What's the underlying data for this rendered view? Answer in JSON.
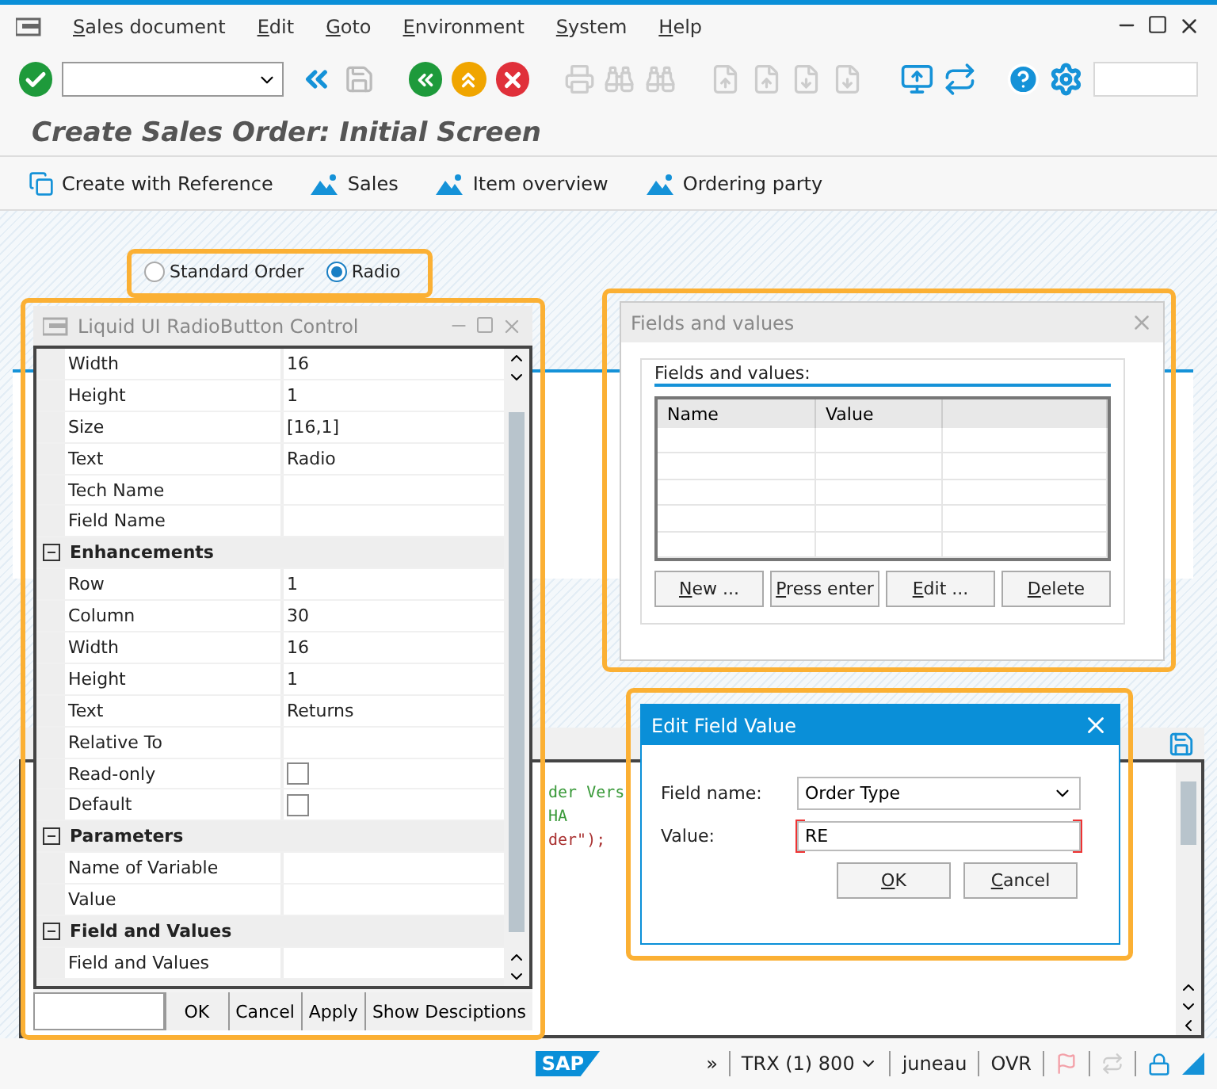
{
  "menu_bar": {
    "items": [
      "Sales document",
      "Edit",
      "Goto",
      "Environment",
      "System",
      "Help"
    ]
  },
  "screen_title": "Create Sales Order: Initial Screen",
  "app_toolbar": [
    {
      "label": "Create with Reference",
      "kind": "reference"
    },
    {
      "label": "Sales",
      "kind": "overview"
    },
    {
      "label": "Item overview",
      "kind": "overview"
    },
    {
      "label": "Ordering party",
      "kind": "overview"
    }
  ],
  "radio_group": [
    {
      "label": "Standard Order",
      "selected": false
    },
    {
      "label": "Radio",
      "selected": true
    }
  ],
  "property_dialog": {
    "title": "Liquid UI RadioButton Control",
    "rows": [
      {
        "kind": "property",
        "name": "Width",
        "value": "16"
      },
      {
        "kind": "property",
        "name": "Height",
        "value": "1"
      },
      {
        "kind": "property",
        "name": "Size",
        "value": "[16,1]"
      },
      {
        "kind": "property",
        "name": "Text",
        "value": "Radio"
      },
      {
        "kind": "property",
        "name": "Tech Name"
      },
      {
        "kind": "property",
        "name": "Field Name"
      },
      {
        "kind": "group",
        "name": "Enhancements",
        "expanded": true
      },
      {
        "kind": "property",
        "name": "Row",
        "value": "1"
      },
      {
        "kind": "property",
        "name": "Column",
        "value": "30"
      },
      {
        "kind": "property",
        "name": "Width",
        "value": "16"
      },
      {
        "kind": "property",
        "name": "Height",
        "value": "1"
      },
      {
        "kind": "property",
        "name": "Text",
        "value": "Returns"
      },
      {
        "kind": "property",
        "name": "Relative To"
      },
      {
        "kind": "checkbox",
        "name": "Read-only",
        "checked": false
      },
      {
        "kind": "checkbox",
        "name": "Default",
        "checked": false
      },
      {
        "kind": "group",
        "name": "Parameters",
        "expanded": true
      },
      {
        "kind": "property",
        "name": "Name of Variable"
      },
      {
        "kind": "property",
        "name": "Value"
      },
      {
        "kind": "group",
        "name": "Field and Values",
        "expanded": true
      },
      {
        "kind": "property",
        "name": "Field and Values"
      }
    ],
    "footer_buttons": [
      "OK",
      "Cancel",
      "Apply",
      "Show Desciptions"
    ]
  },
  "fields_dialog": {
    "title": "Fields and values",
    "group_label": "Fields and values:",
    "columns": [
      "Name",
      "Value"
    ],
    "buttons": [
      "New ...",
      "Press enter",
      "Edit ...",
      "Delete"
    ]
  },
  "edit_dialog": {
    "title": "Edit Field Value",
    "field_name_label": "Field name:",
    "field_name_value": "Order Type",
    "value_label": "Value:",
    "value": "RE",
    "buttons": [
      "OK",
      "Cancel"
    ]
  },
  "code_editor": {
    "lines": [
      {
        "text": "der Vers",
        "kind": "comment"
      },
      {
        "text": "HA",
        "kind": "comment"
      },
      {
        "text": "der\");",
        "kind": "string"
      }
    ]
  },
  "status_bar": {
    "logo": "SAP",
    "more": "»",
    "system": "TRX (1) 800",
    "user": "juneau",
    "mode": "OVR"
  }
}
